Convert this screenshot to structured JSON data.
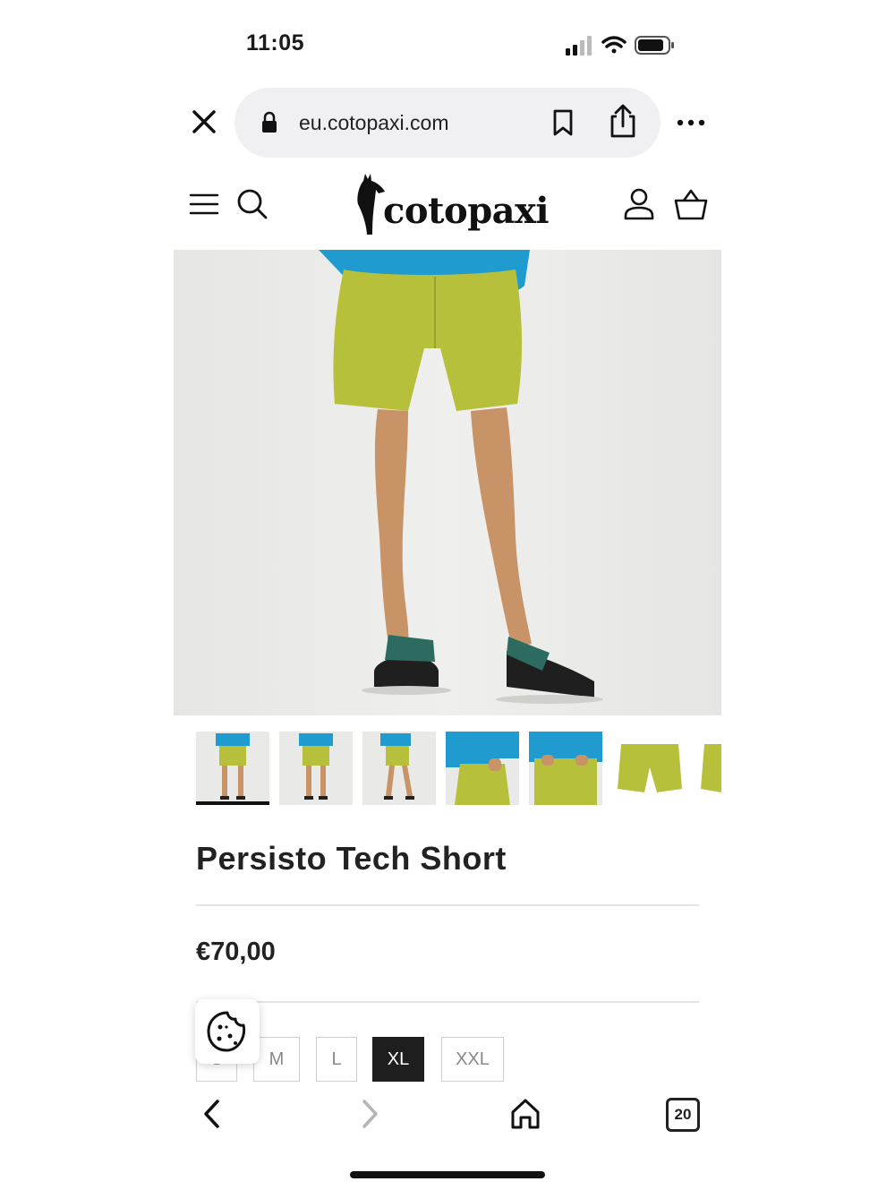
{
  "status_bar": {
    "time": "11:05"
  },
  "browser": {
    "url": "eu.cotopaxi.com",
    "tab_count": "20"
  },
  "site": {
    "brand": "cotopaxi"
  },
  "product": {
    "title": "Persisto Tech Short",
    "price": "€70,00",
    "sizes": [
      "S",
      "M",
      "L",
      "XL",
      "XXL"
    ],
    "selected_size": "XL",
    "thumbnail_count": 7
  },
  "colors": {
    "short": "#b7c03a",
    "jacket": "#1f9bd0",
    "selected": "#1e1e1e",
    "background": "#e9e9e7"
  }
}
